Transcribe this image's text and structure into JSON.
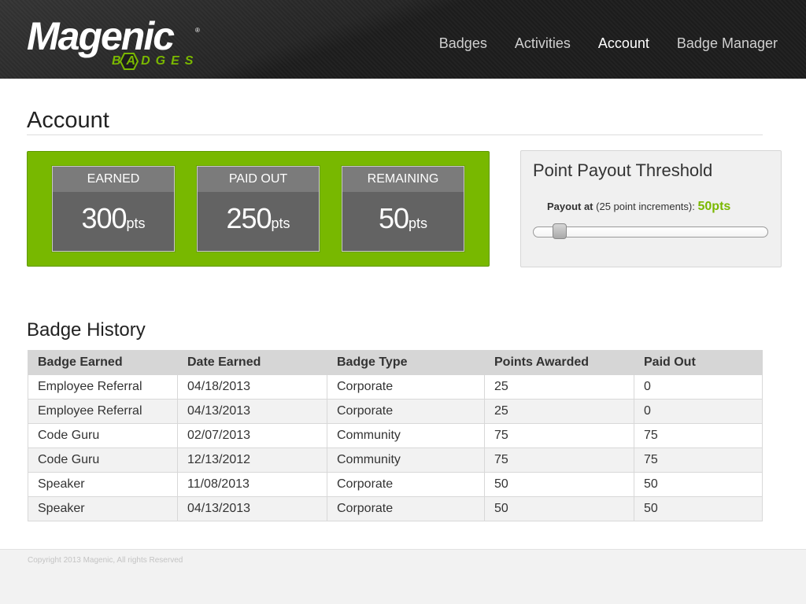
{
  "brand": {
    "name": "Magenic",
    "sub": "BADGES",
    "registered": "®",
    "accent_color": "#7ab800"
  },
  "nav": {
    "items": [
      {
        "label": "Badges",
        "active": false
      },
      {
        "label": "Activities",
        "active": false
      },
      {
        "label": "Account",
        "active": true
      },
      {
        "label": "Badge Manager",
        "active": false
      }
    ]
  },
  "page": {
    "title": "Account"
  },
  "points": {
    "panel_color": "#78b800",
    "earned": {
      "label": "EARNED",
      "value": "300",
      "unit": "pts"
    },
    "paid_out": {
      "label": "PAID OUT",
      "value": "250",
      "unit": "pts"
    },
    "remaining": {
      "label": "REMAINING",
      "value": "50",
      "unit": "pts"
    }
  },
  "threshold": {
    "title": "Point Payout Threshold",
    "label_bold": "Payout at",
    "label_rest": "(25 point increments):",
    "value": "50pts",
    "slider_fraction": 0.11
  },
  "history": {
    "title": "Badge History",
    "columns": [
      "Badge Earned",
      "Date Earned",
      "Badge Type",
      "Points Awarded",
      "Paid Out"
    ],
    "rows": [
      [
        "Employee Referral",
        "04/18/2013",
        "Corporate",
        "25",
        "0"
      ],
      [
        "Employee Referral",
        "04/13/2013",
        "Corporate",
        "25",
        "0"
      ],
      [
        "Code Guru",
        "02/07/2013",
        "Community",
        "75",
        "75"
      ],
      [
        "Code Guru",
        "12/13/2012",
        "Community",
        "75",
        "75"
      ],
      [
        "Speaker",
        "11/08/2013",
        "Corporate",
        "50",
        "50"
      ],
      [
        "Speaker",
        "04/13/2013",
        "Corporate",
        "50",
        "50"
      ]
    ]
  },
  "footer": {
    "text": "Copyright 2013 Magenic, All rights Reserved"
  }
}
